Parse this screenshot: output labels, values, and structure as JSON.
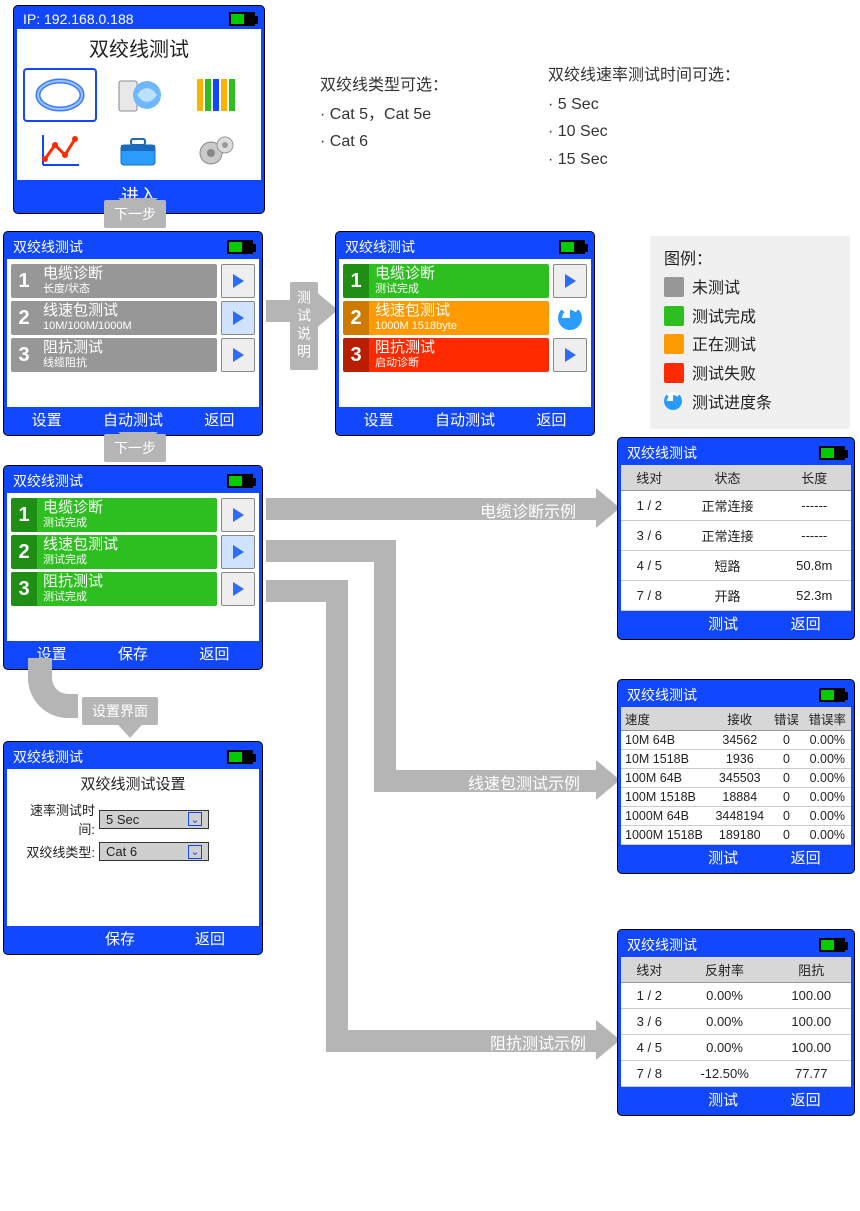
{
  "menu": {
    "ip": "IP: 192.168.0.188",
    "title": "双绞线测试",
    "enter": "进入"
  },
  "notes": {
    "typeHdr": "双绞线类型可选：",
    "type1": "· Cat 5，Cat 5e",
    "type2": "· Cat 6",
    "timeHdr": "双绞线速率测试时间可选：",
    "time1": "· 5 Sec",
    "time2": "· 10 Sec",
    "time3": "· 15 Sec"
  },
  "flow": {
    "next": "下一步",
    "testDesc": "测试说明",
    "settingsUI": "设置界面",
    "cableEx": "电缆诊断示例",
    "speedEx": "线速包测试示例",
    "impEx": "阻抗测试示例"
  },
  "screenA": {
    "title": "双绞线测试",
    "items": [
      {
        "t1": "电缆诊断",
        "t2": "长度/状态"
      },
      {
        "t1": "线速包测试",
        "t2": "10M/100M/1000M"
      },
      {
        "t1": "阻抗测试",
        "t2": "线缆阻抗"
      }
    ],
    "f1": "设置",
    "f2": "自动测试",
    "f3": "返回"
  },
  "screenB": {
    "title": "双绞线测试",
    "items": [
      {
        "t1": "电缆诊断",
        "t2": "测试完成"
      },
      {
        "t1": "线速包测试",
        "t2": "1000M 1518byte"
      },
      {
        "t1": "阻抗测试",
        "t2": "启动诊断"
      }
    ],
    "f1": "设置",
    "f2": "自动测试",
    "f3": "返回"
  },
  "screenC": {
    "title": "双绞线测试",
    "items": [
      {
        "t1": "电缆诊断",
        "t2": "测试完成"
      },
      {
        "t1": "线速包测试",
        "t2": "测试完成"
      },
      {
        "t1": "阻抗测试",
        "t2": "测试完成"
      }
    ],
    "f1": "设置",
    "f2": "保存",
    "f3": "返回"
  },
  "legend": {
    "hd": "图例：",
    "l1": "未测试",
    "l2": "测试完成",
    "l3": "正在测试",
    "l4": "测试失败",
    "l5": "测试进度条"
  },
  "settings": {
    "header": "双绞线测试",
    "title": "双绞线测试设置",
    "row1lbl": "速率测试时间:",
    "row1val": "5 Sec",
    "row2lbl": "双绞线类型:",
    "row2val": "Cat 6",
    "f1": "保存",
    "f2": "返回"
  },
  "tableCable": {
    "title": "双绞线测试",
    "h1": "线对",
    "h2": "状态",
    "h3": "长度",
    "rows": [
      [
        "1 / 2",
        "正常连接",
        "------"
      ],
      [
        "3 / 6",
        "正常连接",
        "------"
      ],
      [
        "4 / 5",
        "短路",
        "50.8m"
      ],
      [
        "7 / 8",
        "开路",
        "52.3m"
      ]
    ],
    "f1": "测试",
    "f2": "返回"
  },
  "tableSpeed": {
    "title": "双绞线测试",
    "h1": "速度",
    "h2": "接收",
    "h3": "错误",
    "h4": "错误率",
    "rows": [
      [
        "10M 64B",
        "34562",
        "0",
        "0.00%"
      ],
      [
        "10M 1518B",
        "1936",
        "0",
        "0.00%"
      ],
      [
        "100M 64B",
        "345503",
        "0",
        "0.00%"
      ],
      [
        "100M 1518B",
        "18884",
        "0",
        "0.00%"
      ],
      [
        "1000M 64B",
        "3448194",
        "0",
        "0.00%"
      ],
      [
        "1000M 1518B",
        "189180",
        "0",
        "0.00%"
      ]
    ],
    "f1": "测试",
    "f2": "返回"
  },
  "tableImp": {
    "title": "双绞线测试",
    "h1": "线对",
    "h2": "反射率",
    "h3": "阻抗",
    "rows": [
      [
        "1 / 2",
        "0.00%",
        "100.00"
      ],
      [
        "3 / 6",
        "0.00%",
        "100.00"
      ],
      [
        "4 / 5",
        "0.00%",
        "100.00"
      ],
      [
        "7 / 8",
        "-12.50%",
        "77.77"
      ]
    ],
    "f1": "测试",
    "f2": "返回"
  },
  "chart_data": {
    "type": "table",
    "tables": [
      {
        "name": "电缆诊断",
        "columns": [
          "线对",
          "状态",
          "长度"
        ],
        "rows": [
          [
            "1 / 2",
            "正常连接",
            null
          ],
          [
            "3 / 6",
            "正常连接",
            null
          ],
          [
            "4 / 5",
            "短路",
            50.8
          ],
          [
            "7 / 8",
            "开路",
            52.3
          ]
        ]
      },
      {
        "name": "线速包测试",
        "columns": [
          "速度",
          "接收",
          "错误",
          "错误率%"
        ],
        "rows": [
          [
            "10M 64B",
            34562,
            0,
            0.0
          ],
          [
            "10M 1518B",
            1936,
            0,
            0.0
          ],
          [
            "100M 64B",
            345503,
            0,
            0.0
          ],
          [
            "100M 1518B",
            18884,
            0,
            0.0
          ],
          [
            "1000M 64B",
            3448194,
            0,
            0.0
          ],
          [
            "1000M 1518B",
            189180,
            0,
            0.0
          ]
        ]
      },
      {
        "name": "阻抗测试",
        "columns": [
          "线对",
          "反射率%",
          "阻抗"
        ],
        "rows": [
          [
            "1 / 2",
            0.0,
            100.0
          ],
          [
            "3 / 6",
            0.0,
            100.0
          ],
          [
            "4 / 5",
            0.0,
            100.0
          ],
          [
            "7 / 8",
            -12.5,
            77.77
          ]
        ]
      }
    ]
  }
}
